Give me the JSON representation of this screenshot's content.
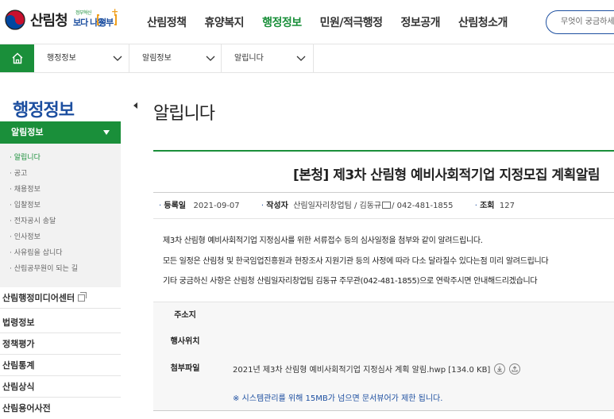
{
  "header": {
    "logo_text": "산림청",
    "slogan_small": "정부혁신",
    "slogan_main": "보다 나은",
    "slogan_word": "정부",
    "nav": [
      "산림정책",
      "휴양복지",
      "행정정보",
      "민원/적극행정",
      "정보공개",
      "산림청소개"
    ],
    "active_nav": "행정정보",
    "search_placeholder": "무엇이 궁금하세요?"
  },
  "breadcrumb": [
    "행정정보",
    "알림정보",
    "알립니다"
  ],
  "sidebar": {
    "title": "행정정보",
    "active_group": "알림정보",
    "sub_items": [
      "알립니다",
      "공고",
      "채용정보",
      "입찰정보",
      "전자공시 송달",
      "인사정보",
      "사유림을 삽니다",
      "산림공무원이 되는 길"
    ],
    "menu": [
      "산림행정미디어센터",
      "법령정보",
      "정책평가",
      "산림통계",
      "산림상식",
      "산림용어사전"
    ]
  },
  "main": {
    "page_title": "알립니다",
    "post_title": "[본청] 제3차 산림형 예비사회적기업 지정모집 계획알림",
    "meta": {
      "date_label": "등록일",
      "date": "2021-09-07",
      "author_label": "작성자",
      "author": "산림일자리창업팀 / 김동규",
      "phone": "/ 042-481-1855",
      "views_label": "조회",
      "views": "127"
    },
    "body": [
      "제3차 산림형 예비사회적기업 지정심사를 위한 서류접수 등의 심사일정을 첨부와 같이 알려드립니다.",
      "모든 일정은 산림청 및 한국임업진흥원과 현장조사 지원기관 등의 사정에 따라 다소 달라질수 있다는점 미리 알려드립니다",
      "기타 궁금하신 사항은 산림청 산림일자리창업팀 김동규 주무관(042-481-1855)으로 연락주시면 안내해드리겠습니다"
    ],
    "info": {
      "address_label": "주소지",
      "location_label": "행사위치",
      "attach_label": "첨부파일",
      "attach_file": "2021년 제3차 산림형 예비사회적기업 지정심사 계획 알림.hwp [134.0 KB]",
      "notice": "※ 시스템관리를 위해 15MB가 넘으면 문서뷰어가 제한 됩니다."
    }
  },
  "colors": {
    "green": "#1a8f3a",
    "blue": "#1d4fa0"
  }
}
